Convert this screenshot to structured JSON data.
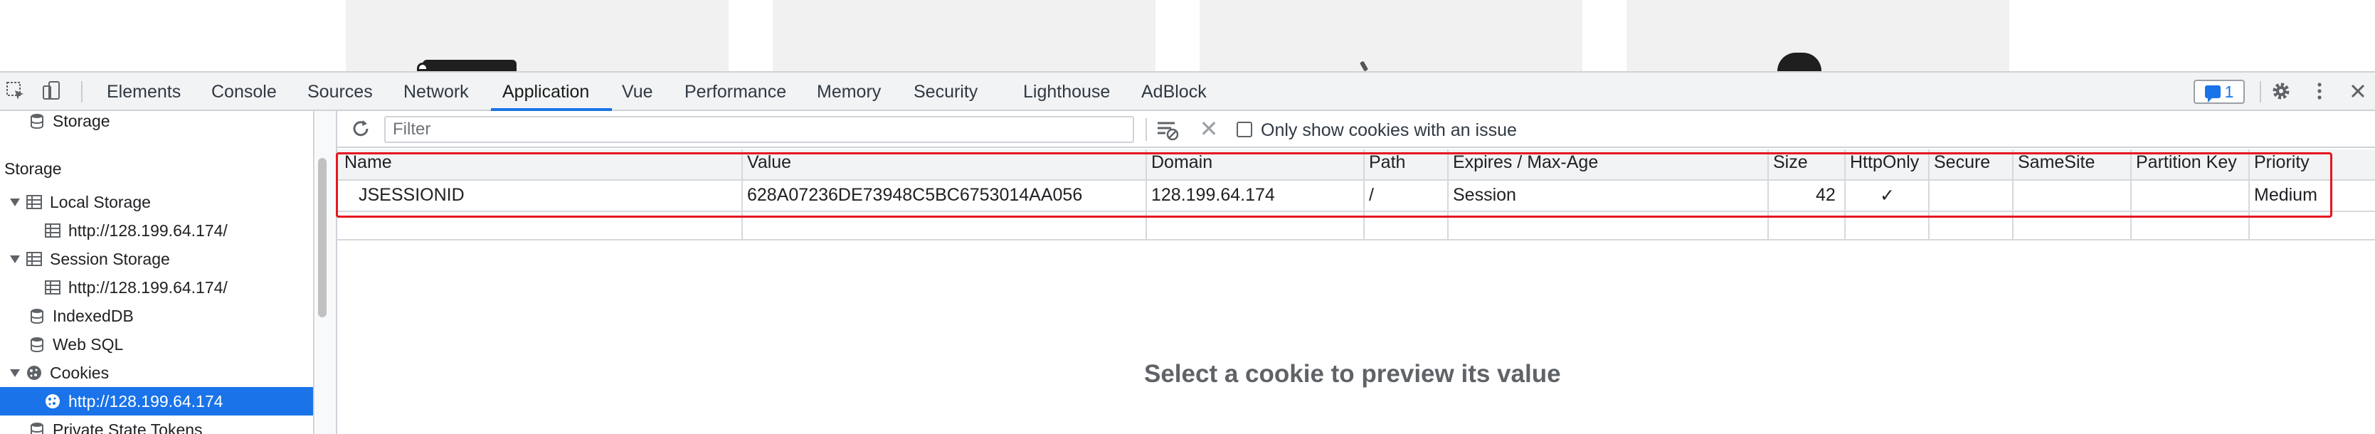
{
  "devtools": {
    "tabs": [
      {
        "label": "Elements"
      },
      {
        "label": "Console"
      },
      {
        "label": "Sources"
      },
      {
        "label": "Network"
      },
      {
        "label": "Application",
        "active": true
      },
      {
        "label": "Vue"
      },
      {
        "label": "Performance"
      },
      {
        "label": "Memory"
      },
      {
        "label": "Security"
      },
      {
        "label": "Lighthouse"
      },
      {
        "label": "AdBlock"
      }
    ],
    "issues_count": "1",
    "accent_color": "#1a73e8",
    "icons": [
      "inspect-element-icon",
      "device-toolbar-icon",
      "issues-icon",
      "settings-gear-icon",
      "more-vertical-icon",
      "close-icon"
    ]
  },
  "sidebar": {
    "top_item": "Storage",
    "section_heading": "Storage",
    "items": [
      {
        "label": "Local Storage",
        "icon": "grid-icon",
        "expanded": true
      },
      {
        "label": "http://128.199.64.174/",
        "icon": "grid-icon",
        "child": true
      },
      {
        "label": "Session Storage",
        "icon": "grid-icon",
        "expanded": true
      },
      {
        "label": "http://128.199.64.174/",
        "icon": "grid-icon",
        "child": true
      },
      {
        "label": "IndexedDB",
        "icon": "database-icon"
      },
      {
        "label": "Web SQL",
        "icon": "database-icon"
      },
      {
        "label": "Cookies",
        "icon": "cookie-icon",
        "expanded": true
      },
      {
        "label": "http://128.199.64.174",
        "icon": "cookie-icon",
        "child": true,
        "selected": true
      },
      {
        "label": "Private State Tokens",
        "icon": "database-icon"
      }
    ]
  },
  "toolbar": {
    "filter_placeholder": "Filter",
    "only_issues_label": "Only show cookies with an issue",
    "only_issues_checked": false
  },
  "cookies_table": {
    "columns": [
      "Name",
      "Value",
      "Domain",
      "Path",
      "Expires / Max-Age",
      "Size",
      "HttpOnly",
      "Secure",
      "SameSite",
      "Partition Key",
      "Priority"
    ],
    "rows": [
      {
        "name": "JSESSIONID",
        "value": "628A07236DE73948C5BC6753014AA056",
        "domain": "128.199.64.174",
        "path": "/",
        "expires": "Session",
        "size": "42",
        "httponly": "✓",
        "secure": "",
        "samesite": "",
        "partition_key": "",
        "priority": "Medium"
      }
    ],
    "highlight_color": "#e4161e"
  },
  "preview": {
    "message": "Select a cookie to preview its value"
  }
}
